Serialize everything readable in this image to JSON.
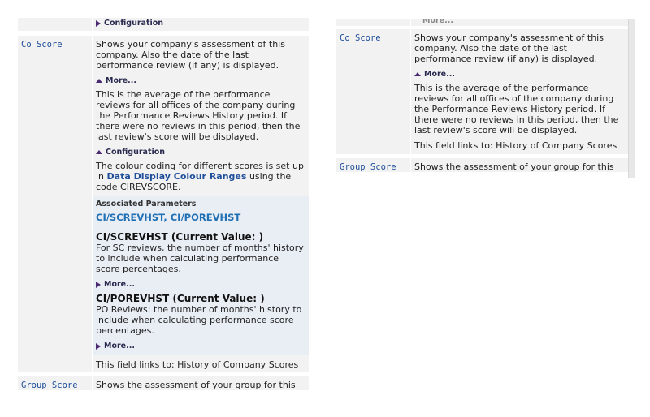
{
  "left": {
    "top_toggle": "Configuration",
    "co_score": {
      "field": "Co Score",
      "summary": "Shows your company's assessment of this company. Also the date of the last performance review (if any) is displayed.",
      "more_label": "More...",
      "more_text": "This is the average of the performance reviews for all offices of the company during the Performance Reviews History period. If there were no reviews in this period, then the last review's score will be displayed.",
      "config_label": "Configuration",
      "config_text_1": "The colour coding for different scores is set up in",
      "config_link": "Data Display Colour Ranges",
      "config_text_2": "using the code CIREVSCORE.",
      "assoc_title": "Associated Parameters",
      "assoc_links": "CI/SCREVHST, CI/POREVHST",
      "params": [
        {
          "name": "CI/SCREVHST (Current Value: )",
          "desc": "For SC reviews, the number of months' history to include when calculating performance score percentages.",
          "more": "More..."
        },
        {
          "name": "CI/POREVHST (Current Value: )",
          "desc": "PO Reviews: the number of months' history to include when calculating performance score percentages.",
          "more": "More..."
        }
      ],
      "links_to": "This field links to: History of Company Scores"
    },
    "group_score": {
      "field": "Group Score",
      "summary": "Shows the assessment of your group for this"
    }
  },
  "right": {
    "top_toggle": "More...",
    "co_score": {
      "field": "Co Score",
      "summary": "Shows your company's assessment of this company. Also the date of the last performance review (if any) is displayed.",
      "more_label": "More...",
      "more_text": "This is the average of the performance reviews for all offices of the company during the Performance Reviews History period. If there were no reviews in this period, then the last review's score will be displayed.",
      "links_to": "This field links to: History of Company Scores"
    },
    "group_score": {
      "field": "Group Score",
      "summary": "Shows the assessment of your group for this"
    }
  }
}
